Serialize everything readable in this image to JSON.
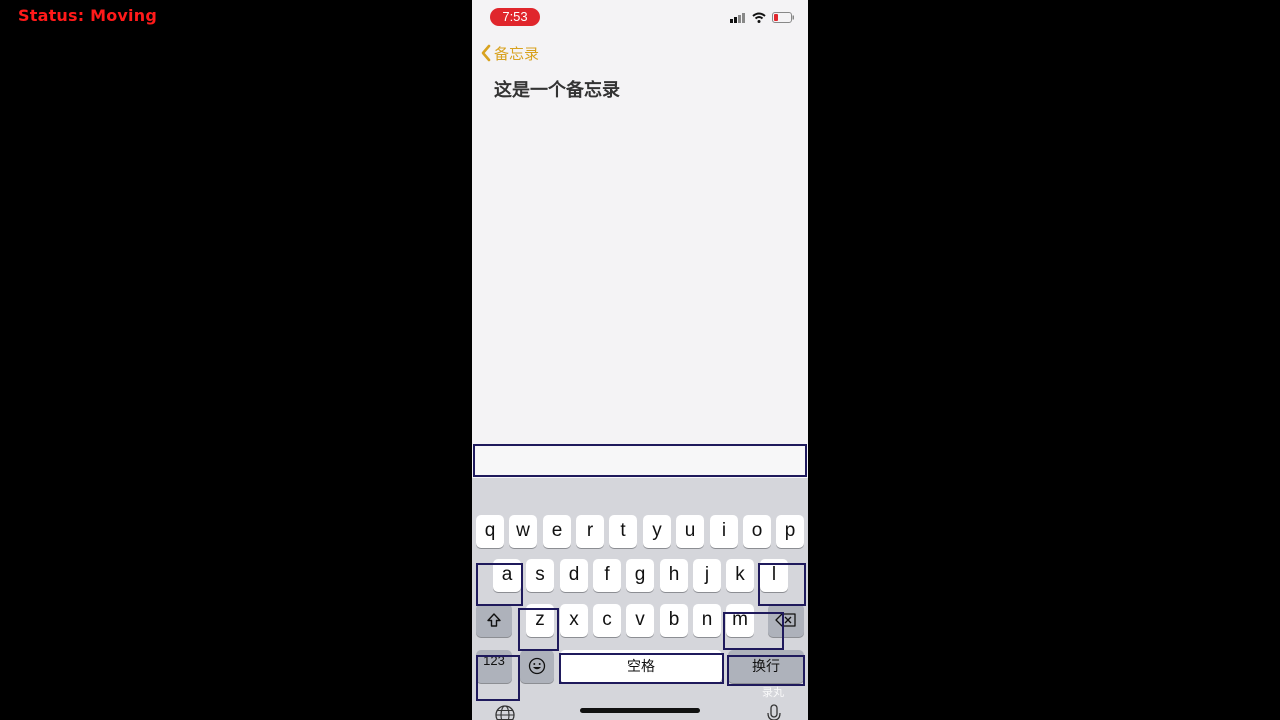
{
  "overlay": {
    "status": "Status: Moving"
  },
  "status_bar": {
    "time": "7:53",
    "time_color": "#e0262c"
  },
  "nav": {
    "back_label": "备忘录",
    "accent_color": "#d8a21f"
  },
  "note": {
    "title": "这是一个备忘录"
  },
  "keyboard": {
    "row1": [
      "q",
      "w",
      "e",
      "r",
      "t",
      "y",
      "u",
      "i",
      "o",
      "p"
    ],
    "row2": [
      "a",
      "s",
      "d",
      "f",
      "g",
      "h",
      "j",
      "k",
      "l"
    ],
    "row3": [
      "z",
      "x",
      "c",
      "v",
      "b",
      "n",
      "m"
    ],
    "shift_icon": "shift-icon",
    "delete_icon": "delete-icon",
    "numbers_label": "123",
    "emoji_icon": "emoji-icon",
    "space_label": "空格",
    "return_label": "换行",
    "globe_icon": "globe-icon",
    "mic_icon": "mic-icon",
    "watermark": "录丸"
  }
}
